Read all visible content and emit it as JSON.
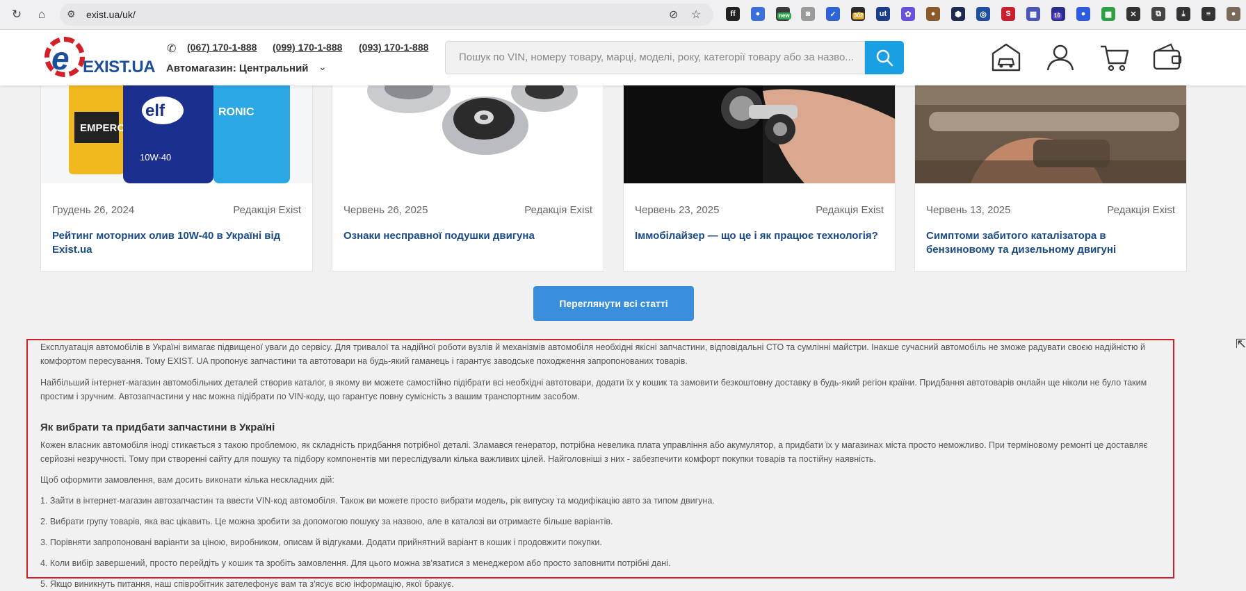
{
  "browser": {
    "url": "exist.ua/uk/",
    "extensions": [
      {
        "icon": "ff-icon",
        "color": "#222222",
        "glyph": "ff"
      },
      {
        "icon": "circle-multicolor-icon",
        "color": "#3b6fd9",
        "glyph": "●"
      },
      {
        "icon": "tablet-new-icon",
        "color": "#3a3a3a",
        "glyph": "▭",
        "badge": "new"
      },
      {
        "icon": "camera-icon",
        "color": "#9a9a9a",
        "glyph": "◙"
      },
      {
        "icon": "check-icon",
        "color": "#2f64d6",
        "glyph": "✓"
      },
      {
        "icon": "badge-302-icon",
        "color": "#2a2a2a",
        "glyph": "↗",
        "badge": "302"
      },
      {
        "icon": "ut-icon",
        "color": "#1d3f8a",
        "glyph": "ut"
      },
      {
        "icon": "purple-gear-icon",
        "color": "#6a4fd9",
        "glyph": "✿"
      },
      {
        "icon": "cookie-icon",
        "color": "#8a5a2a",
        "glyph": "●"
      },
      {
        "icon": "hex-icon",
        "color": "#1e2b4f",
        "glyph": "⬢"
      },
      {
        "icon": "lens-icon",
        "color": "#1f4fa3",
        "glyph": "◎"
      },
      {
        "icon": "red-shield-icon",
        "color": "#c8202f",
        "glyph": "S"
      },
      {
        "icon": "reader-icon",
        "color": "#4b57b8",
        "glyph": "▦"
      },
      {
        "icon": "home-badge-icon",
        "color": "#2a2f8a",
        "glyph": "⌂",
        "badge": "16"
      },
      {
        "icon": "blue-dot-icon",
        "color": "#2e5be0",
        "glyph": "●"
      },
      {
        "icon": "grid-color-icon",
        "color": "#2ea043",
        "glyph": "▩"
      },
      {
        "icon": "close-x-icon",
        "color": "#333333",
        "glyph": "✕"
      },
      {
        "icon": "puzzle-icon",
        "color": "#444444",
        "glyph": "⧉"
      },
      {
        "icon": "download-icon",
        "color": "#333333",
        "glyph": "⤓"
      },
      {
        "icon": "media-icon",
        "color": "#333333",
        "glyph": "≡"
      },
      {
        "icon": "profile-avatar-icon",
        "color": "#7a6a5a",
        "glyph": "●"
      }
    ]
  },
  "header": {
    "logo_text": "EXIST.UA",
    "phones": [
      "(067) 170-1-888",
      "(099) 170-1-888",
      "(093) 170-1-888"
    ],
    "store": "Автомагазин: Центральний",
    "search_placeholder": "Пошук по VIN, номеру товару, марці, моделі, року, категорії товару або за назво..."
  },
  "articles": [
    {
      "date": "Грудень 26, 2024",
      "author": "Редакція Exist",
      "title": "Рейтинг моторних олив 10W-40 в Україні від Exist.ua",
      "image": "motor-oil-bottles"
    },
    {
      "date": "Червень 26, 2025",
      "author": "Редакція Exist",
      "title": "Ознаки несправної подушки двигуна",
      "image": "engine-mounts"
    },
    {
      "date": "Червень 23, 2025",
      "author": "Редакція Exist",
      "title": "Іммобілайзер — що це і як працює технологія?",
      "image": "car-key-ignition"
    },
    {
      "date": "Червень 13, 2025",
      "author": "Редакція Exist",
      "title": "Симптоми забитого каталізатора в бензиновому та дизельному двигуні",
      "image": "catalytic-converter"
    }
  ],
  "all_articles_label": "Переглянути всі статті",
  "seo": {
    "p1": "Експлуатація автомобілів в Україні вимагає підвищеної уваги до сервісу. Для тривалої та надійної роботи вузлів й механізмів автомобіля необхідні якісні запчастини, відповідальні СТО та сумлінні майстри. Інакше сучасний автомобіль не зможе радувати своєю надійністю й комфортом пересування. Тому EXIST. UA пропонує запчастини та автотовари на будь-який гаманець і гарантує заводське походження запропонованих товарів.",
    "p2": "Найбільший інтернет-магазин автомобільних деталей створив каталог, в якому ви можете самостійно підібрати всі необхідні автотовари, додати їх у кошик та замовити безкоштовну доставку в будь-який регіон країни. Придбання автотоварів онлайн ще ніколи не було таким простим і зручним. Автозапчастини у нас можна підібрати по VIN-коду, що гарантує повну сумісність з вашим транспортним засобом.",
    "heading": "Як вибрати та придбати запчастини в Україні",
    "p3": "Кожен власник автомобіля іноді стикається з такою проблемою, як складність придбання потрібної деталі. Зламався генератор, потрібна невелика плата управління або акумулятор, а придбати їх у магазинах міста просто неможливо. При терміновому ремонті це доставляє серйозні незручності. Тому при створенні сайту для пошуку та підбору компонентів ми переслідували кілька важливих цілей. Найголовніші з них - забезпечити комфорт покупки товарів та постійну наявність.",
    "p4": "Щоб оформити замовлення, вам досить виконати кілька нескладних дій:",
    "steps": [
      "1. Зайти в інтернет-магазин автозапчастин та ввести VIN-код автомобіля. Також ви можете просто вибрати модель, рік випуску та модифікацію авто за типом двигуна.",
      "2. Вибрати групу товарів, яка вас цікавить. Це можна зробити за допомогою пошуку за назвою, але в каталозі ви отримаєте більше варіантів.",
      "3. Порівняти запропоновані варіанти за ціною, виробником, описам й відгуками. Додати прийнятний варіант в кошик і продовжити покупки.",
      "4. Коли вибір завершений, просто перейдіть у кошик та зробіть замовлення. Для цього можна зв'язатися з менеджером або просто заповнити потрібні дані.",
      "5. Якщо виникнуть питання, наш співробітник зателефонує вам та з'ясує всю інформацію, якої бракує."
    ]
  },
  "colors": {
    "accent_blue": "#19a0e4",
    "button_blue": "#3a8fdc",
    "title_blue": "#1a4a86",
    "highlight_red": "#d0202a",
    "logo_red": "#d42027",
    "logo_blue": "#1c4f9c"
  }
}
